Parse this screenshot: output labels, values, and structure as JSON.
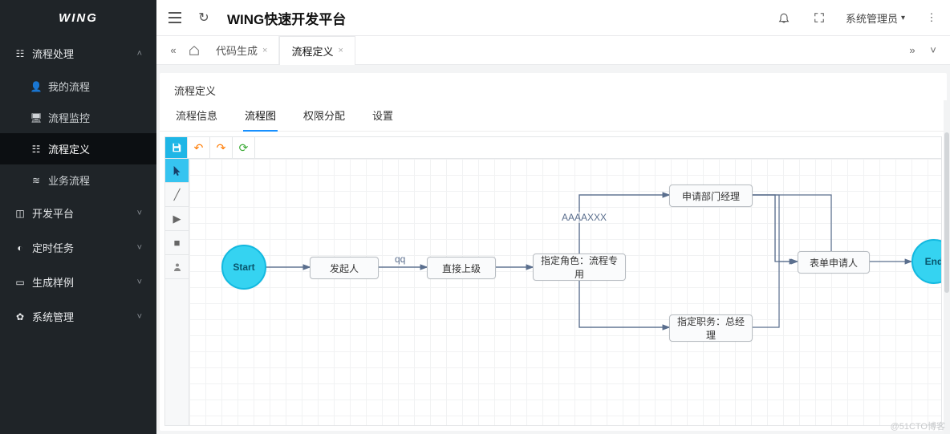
{
  "brand": "WING",
  "header": {
    "title": "WING快速开发平台",
    "user": "系统管理员"
  },
  "sidebar": {
    "groups": [
      {
        "label": "流程处理",
        "icon": "⚙",
        "expanded": true,
        "items": [
          {
            "label": "我的流程",
            "icon": "👤"
          },
          {
            "label": "流程监控",
            "icon": "🖥"
          },
          {
            "label": "流程定义",
            "icon": "⊞",
            "active": true
          },
          {
            "label": "业务流程",
            "icon": "≋"
          }
        ]
      },
      {
        "label": "开发平台",
        "icon": "⊞"
      },
      {
        "label": "定时任务",
        "icon": "◐"
      },
      {
        "label": "生成样例",
        "icon": "▭"
      },
      {
        "label": "系统管理",
        "icon": "✿"
      }
    ]
  },
  "tabs": {
    "items": [
      {
        "label": "代码生成"
      },
      {
        "label": "流程定义",
        "active": true
      }
    ]
  },
  "panel": {
    "title": "流程定义",
    "tabs": [
      {
        "label": "流程信息"
      },
      {
        "label": "流程图",
        "active": true
      },
      {
        "label": "权限分配"
      },
      {
        "label": "设置"
      }
    ]
  },
  "flow": {
    "nodes": {
      "start": {
        "label": "Start"
      },
      "n1": {
        "label": "发起人"
      },
      "n2": {
        "label": "直接上级"
      },
      "n3": {
        "label": "指定角色：流程专用"
      },
      "n4": {
        "label": "申请部门经理"
      },
      "n5": {
        "label": "指定职务：总经理"
      },
      "n6": {
        "label": "表单申请人"
      },
      "end": {
        "label": "End"
      }
    },
    "edgeLabels": {
      "e1": "qq",
      "e2": "AAAAXXX"
    }
  },
  "watermark": "@51CTO博客"
}
